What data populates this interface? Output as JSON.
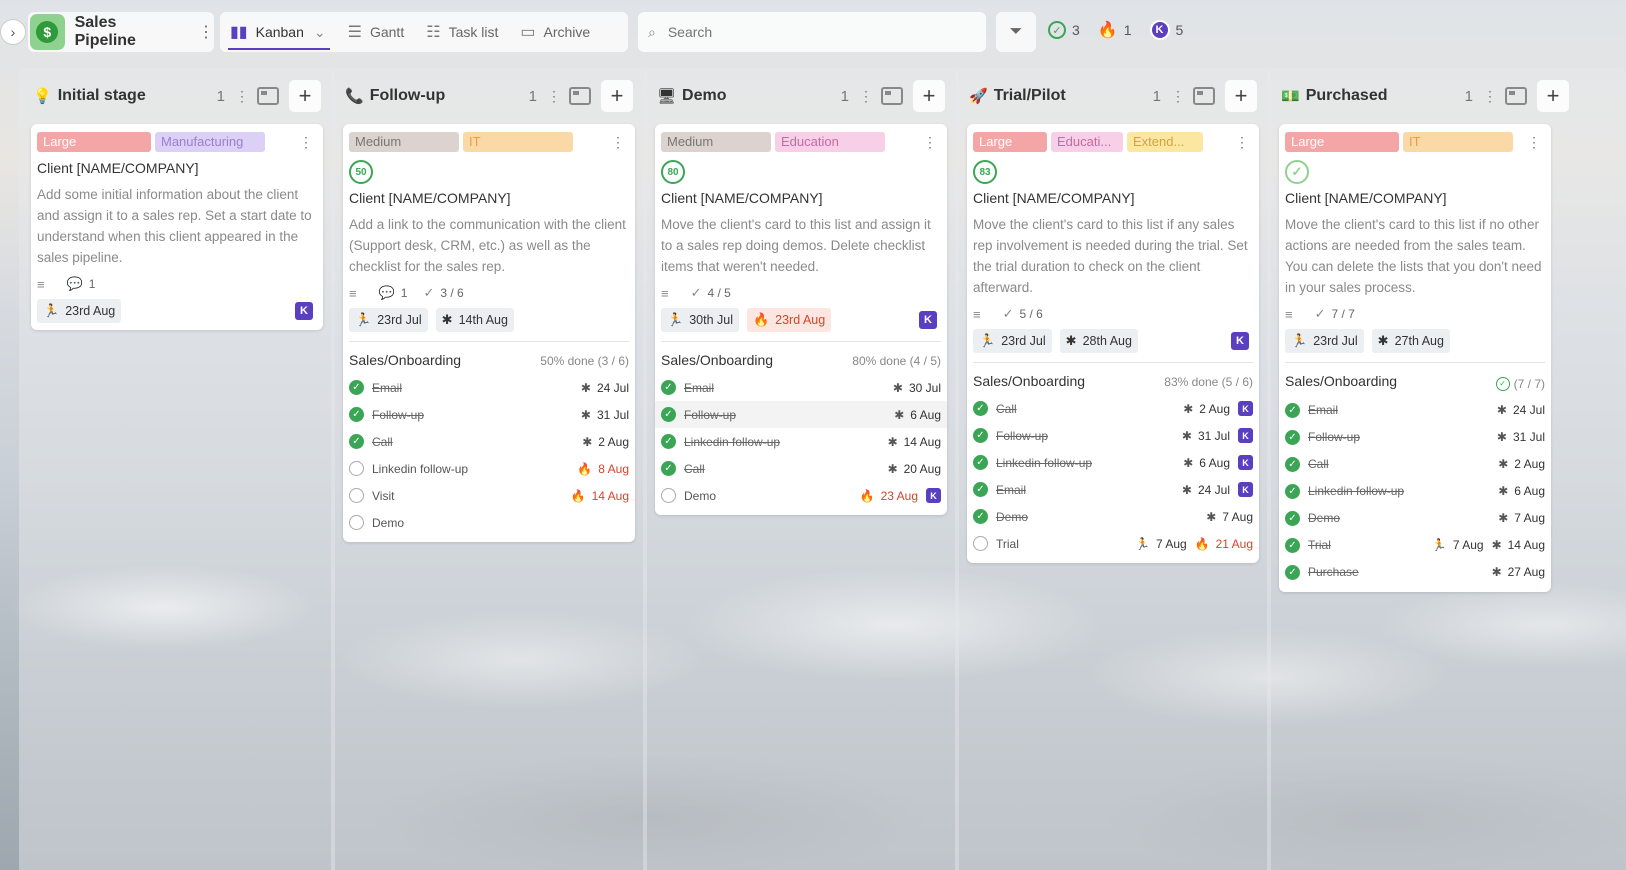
{
  "header": {
    "board_title": "Sales Pipeline",
    "board_icon": "dollar-icon",
    "tabs": [
      {
        "label": "Kanban",
        "icon": "kanban-icon",
        "active": true
      },
      {
        "label": "Gantt",
        "icon": "gantt-icon"
      },
      {
        "label": "Task list",
        "icon": "list-icon"
      },
      {
        "label": "Archive",
        "icon": "archive-icon"
      }
    ],
    "search_placeholder": "Search",
    "stats": {
      "done": "3",
      "overdue": "1",
      "user_initial": "K",
      "user_count": "5"
    }
  },
  "colors": {
    "accent": "#5a3fc0",
    "green": "#3aa655",
    "red": "#e2452b"
  },
  "columns": [
    {
      "title": "Initial stage",
      "emoji": "💡",
      "count": "1",
      "card": {
        "tags": [
          "Large",
          "Manufacturing"
        ],
        "title": "Client [NAME/COMPANY]",
        "desc": "Add some initial information about the client and assign it to a sales rep. Set a start date to understand when this client appeared in the sales pipeline.",
        "comments": "1",
        "start": "23rd Aug",
        "avatar": "K"
      }
    },
    {
      "title": "Follow-up",
      "emoji": "📞",
      "count": "1",
      "card": {
        "tags": [
          "Medium",
          "IT"
        ],
        "progress": "50",
        "title": "Client [NAME/COMPANY]",
        "desc": "Add a link to the communication with the client (Support desk, CRM, etc.) as well as the checklist for the sales rep.",
        "comments": "1",
        "checks": "3 / 6",
        "start": "23rd Jul",
        "due": "14th Aug",
        "checklist_title": "Sales/Onboarding",
        "checklist_progress": "50% done (3 / 6)",
        "items": [
          {
            "label": "Email",
            "date": "24 Jul"
          },
          {
            "label": "Follow-up",
            "date": "31 Jul"
          },
          {
            "label": "Call",
            "date": "2 Aug"
          },
          {
            "label": "Linkedin follow-up",
            "date": "8 Aug"
          },
          {
            "label": "Visit",
            "date": "14 Aug"
          },
          {
            "label": "Demo"
          }
        ]
      }
    },
    {
      "title": "Demo",
      "emoji": "🖥",
      "count": "1",
      "card": {
        "tags": [
          "Medium",
          "Education"
        ],
        "progress": "80",
        "title": "Client [NAME/COMPANY]",
        "desc": "Move the client's card to this list and assign it to a sales rep doing demos. Delete checklist items that weren't needed.",
        "checks": "4 / 5",
        "start": "30th Jul",
        "due": "23rd Aug",
        "avatar": "K",
        "checklist_title": "Sales/Onboarding",
        "checklist_progress": "80% done (4 / 5)",
        "items": [
          {
            "label": "Email",
            "date": "30 Jul"
          },
          {
            "label": "Follow-up",
            "date": "6 Aug"
          },
          {
            "label": "Linkedin follow-up",
            "date": "14 Aug"
          },
          {
            "label": "Call",
            "date": "20 Aug"
          },
          {
            "label": "Demo",
            "date": "23 Aug",
            "avatar": "K"
          }
        ]
      }
    },
    {
      "title": "Trial/Pilot",
      "emoji": "🚀",
      "count": "1",
      "card": {
        "tags": [
          "Large",
          "Educati...",
          "Extend..."
        ],
        "progress": "83",
        "title": "Client [NAME/COMPANY]",
        "desc": "Move the client's card to this list if any sales rep involvement is needed during the trial. Set the trial duration to check on the client afterward.",
        "checks": "5 / 6",
        "start": "23rd Jul",
        "due": "28th Aug",
        "avatar": "K",
        "checklist_title": "Sales/Onboarding",
        "checklist_progress": "83% done (5 / 6)",
        "items": [
          {
            "label": "Call",
            "date": "2 Aug",
            "avatar": "K"
          },
          {
            "label": "Follow-up",
            "date": "31 Jul",
            "avatar": "K"
          },
          {
            "label": "Linkedin follow-up",
            "date": "6 Aug",
            "avatar": "K"
          },
          {
            "label": "Email",
            "date": "24 Jul",
            "avatar": "K"
          },
          {
            "label": "Demo",
            "date": "7 Aug"
          },
          {
            "label": "Trial",
            "start": "7 Aug",
            "date": "21 Aug"
          }
        ]
      }
    },
    {
      "title": "Purchased",
      "emoji": "💵",
      "count": "1",
      "card": {
        "tags": [
          "Large",
          "IT"
        ],
        "title": "Client [NAME/COMPANY]",
        "desc": "Move the client's card to this list if no other actions are needed from the sales team. You can delete the lists that you don't need in your sales process.",
        "checks": "7 / 7",
        "start": "23rd Jul",
        "due": "27th Aug",
        "checklist_title": "Sales/Onboarding",
        "checklist_progress": "(7 / 7)",
        "items": [
          {
            "label": "Email",
            "date": "24 Jul"
          },
          {
            "label": "Follow-up",
            "date": "31 Jul"
          },
          {
            "label": "Call",
            "date": "2 Aug"
          },
          {
            "label": "Linkedin follow-up",
            "date": "6 Aug"
          },
          {
            "label": "Demo",
            "date": "7 Aug"
          },
          {
            "label": "Trial",
            "start": "7 Aug",
            "date": "14 Aug"
          },
          {
            "label": "Purchase",
            "date": "27 Aug"
          }
        ]
      }
    }
  ]
}
